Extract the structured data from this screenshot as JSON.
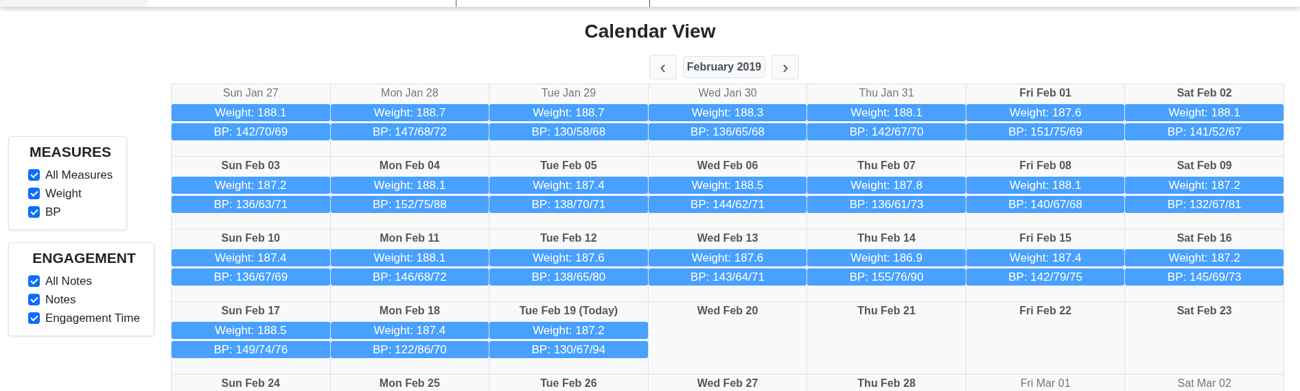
{
  "title": "Calendar View",
  "nav": {
    "prev": "‹",
    "month": "February 2019",
    "next": "›"
  },
  "filters": [
    {
      "title": "MEASURES",
      "options": [
        {
          "label": "All Measures",
          "checked": true
        },
        {
          "label": "Weight",
          "checked": true
        },
        {
          "label": "BP",
          "checked": true
        }
      ]
    },
    {
      "title": "ENGAGEMENT",
      "options": [
        {
          "label": "All Notes",
          "checked": true
        },
        {
          "label": "Notes",
          "checked": true
        },
        {
          "label": "Engagement Time",
          "checked": true
        }
      ]
    }
  ],
  "weeks": [
    [
      {
        "label": "Sun Jan 27",
        "in_month": false,
        "events": [
          "Weight: 188.1",
          "BP: 142/70/69"
        ]
      },
      {
        "label": "Mon Jan 28",
        "in_month": false,
        "events": [
          "Weight: 188.7",
          "BP: 147/68/72"
        ]
      },
      {
        "label": "Tue Jan 29",
        "in_month": false,
        "events": [
          "Weight: 188.7",
          "BP: 130/58/68"
        ]
      },
      {
        "label": "Wed Jan 30",
        "in_month": false,
        "events": [
          "Weight: 188.3",
          "BP: 136/65/68"
        ]
      },
      {
        "label": "Thu Jan 31",
        "in_month": false,
        "events": [
          "Weight: 188.1",
          "BP: 142/67/70"
        ]
      },
      {
        "label": "Fri Feb 01",
        "in_month": true,
        "events": [
          "Weight: 187.6",
          "BP: 151/75/69"
        ]
      },
      {
        "label": "Sat Feb 02",
        "in_month": true,
        "events": [
          "Weight: 188.1",
          "BP: 141/52/67"
        ]
      }
    ],
    [
      {
        "label": "Sun Feb 03",
        "in_month": true,
        "events": [
          "Weight: 187.2",
          "BP: 136/63/71"
        ]
      },
      {
        "label": "Mon Feb 04",
        "in_month": true,
        "events": [
          "Weight: 188.1",
          "BP: 152/75/88"
        ]
      },
      {
        "label": "Tue Feb 05",
        "in_month": true,
        "events": [
          "Weight: 187.4",
          "BP: 138/70/71"
        ]
      },
      {
        "label": "Wed Feb 06",
        "in_month": true,
        "events": [
          "Weight: 188.5",
          "BP: 144/62/71"
        ]
      },
      {
        "label": "Thu Feb 07",
        "in_month": true,
        "events": [
          "Weight: 187.8",
          "BP: 136/61/73"
        ]
      },
      {
        "label": "Fri Feb 08",
        "in_month": true,
        "events": [
          "Weight: 188.1",
          "BP: 140/67/68"
        ]
      },
      {
        "label": "Sat Feb 09",
        "in_month": true,
        "events": [
          "Weight: 187.2",
          "BP: 132/67/81"
        ]
      }
    ],
    [
      {
        "label": "Sun Feb 10",
        "in_month": true,
        "events": [
          "Weight: 187.4",
          "BP: 136/67/69"
        ]
      },
      {
        "label": "Mon Feb 11",
        "in_month": true,
        "events": [
          "Weight: 188.1",
          "BP: 146/68/72"
        ]
      },
      {
        "label": "Tue Feb 12",
        "in_month": true,
        "events": [
          "Weight: 187.6",
          "BP: 138/65/80"
        ]
      },
      {
        "label": "Wed Feb 13",
        "in_month": true,
        "events": [
          "Weight: 187.6",
          "BP: 143/64/71"
        ]
      },
      {
        "label": "Thu Feb 14",
        "in_month": true,
        "events": [
          "Weight: 186.9",
          "BP: 155/76/90"
        ]
      },
      {
        "label": "Fri Feb 15",
        "in_month": true,
        "events": [
          "Weight: 187.4",
          "BP: 142/79/75"
        ]
      },
      {
        "label": "Sat Feb 16",
        "in_month": true,
        "events": [
          "Weight: 187.2",
          "BP: 145/69/73"
        ]
      }
    ],
    [
      {
        "label": "Sun Feb 17",
        "in_month": true,
        "events": [
          "Weight: 188.5",
          "BP: 149/74/76"
        ]
      },
      {
        "label": "Mon Feb 18",
        "in_month": true,
        "events": [
          "Weight: 187.4",
          "BP: 122/86/70"
        ]
      },
      {
        "label": "Tue Feb 19 (Today)",
        "in_month": true,
        "events": [
          "Weight: 187.2",
          "BP: 130/67/94"
        ]
      },
      {
        "label": "Wed Feb 20",
        "in_month": true
      },
      {
        "label": "Thu Feb 21",
        "in_month": true
      },
      {
        "label": "Fri Feb 22",
        "in_month": true
      },
      {
        "label": "Sat Feb 23",
        "in_month": true
      }
    ],
    [
      {
        "label": "Sun Feb 24",
        "in_month": true
      },
      {
        "label": "Mon Feb 25",
        "in_month": true
      },
      {
        "label": "Tue Feb 26",
        "in_month": true
      },
      {
        "label": "Wed Feb 27",
        "in_month": true
      },
      {
        "label": "Thu Feb 28",
        "in_month": true
      },
      {
        "label": "Fri Mar 01",
        "in_month": false
      },
      {
        "label": "Sat Mar 02",
        "in_month": false
      }
    ]
  ]
}
